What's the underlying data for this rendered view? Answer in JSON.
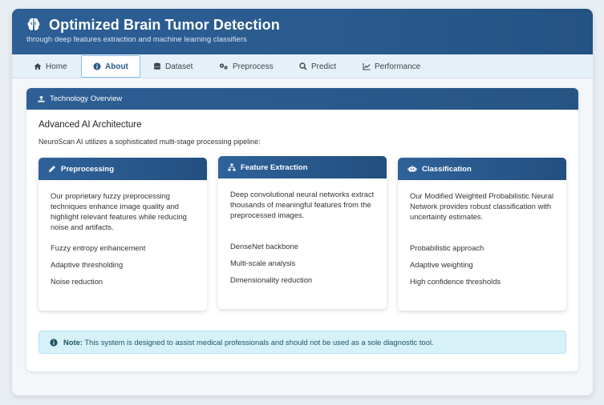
{
  "header": {
    "title": "Optimized Brain Tumor Detection",
    "subtitle": "through deep features extraction and machine learning classifiers"
  },
  "nav": [
    {
      "label": "Home",
      "icon": "home-icon"
    },
    {
      "label": "About",
      "icon": "info-icon",
      "active": true
    },
    {
      "label": "Dataset",
      "icon": "database-icon"
    },
    {
      "label": "Preprocess",
      "icon": "gears-icon"
    },
    {
      "label": "Predict",
      "icon": "search-icon"
    },
    {
      "label": "Performance",
      "icon": "chart-line-icon"
    }
  ],
  "panel": {
    "title": "Technology Overview",
    "heading": "Advanced AI Architecture",
    "intro": "NeuroScan AI utilizes a sophisticated multi-stage processing pipeline:"
  },
  "cards": [
    {
      "title": "Preprocessing",
      "icon": "pencil-icon",
      "description": "Our proprietary fuzzy preprocessing techniques enhance image quality and highlight relevant features while reducing noise and artifacts.",
      "features": [
        "Fuzzy entropy enhancement",
        "Adaptive thresholding",
        "Noise reduction"
      ]
    },
    {
      "title": "Feature Extraction",
      "icon": "sitemap-icon",
      "description": "Deep convolutional neural networks extract thousands of meaningful features from the preprocessed images.",
      "features": [
        "DenseNet backbone",
        "Multi-scale analysis",
        "Dimensionality reduction"
      ]
    },
    {
      "title": "Classification",
      "icon": "robot-icon",
      "description": "Our Modified Weighted Probabilistic Neural Network provides robust classification with uncertainty estimates.",
      "features": [
        "Probabilistic approach",
        "Adaptive weighting",
        "High confidence thresholds"
      ]
    }
  ],
  "note": {
    "label": "Note:",
    "text": " This system is designed to assist medical professionals and should not be used as a sole diagnostic tool."
  },
  "colors": {
    "header": "#2a5a8d",
    "nav_bg": "#e6f0f8",
    "note_bg": "#d6f1f8"
  }
}
